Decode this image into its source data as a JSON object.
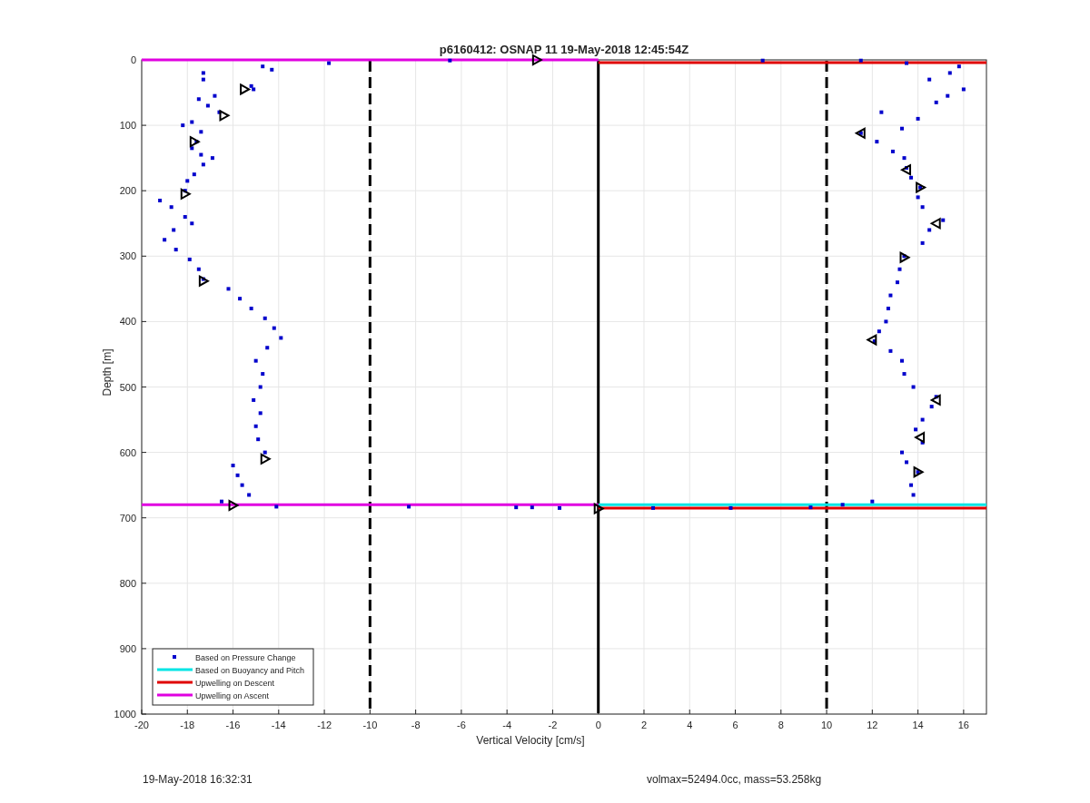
{
  "chart_data": {
    "type": "scatter",
    "title": "p6160412: OSNAP 11 19-May-2018 12:45:54Z",
    "xlabel": "Vertical Velocity [cm/s]",
    "ylabel": "Depth [m]",
    "xlim": [
      -20,
      17
    ],
    "ylim": [
      1000,
      0
    ],
    "xticks": [
      -20,
      -18,
      -16,
      -14,
      -12,
      -10,
      -8,
      -6,
      -4,
      -2,
      0,
      2,
      4,
      6,
      8,
      10,
      12,
      14,
      16
    ],
    "yticks": [
      0,
      100,
      200,
      300,
      400,
      500,
      600,
      700,
      800,
      900,
      1000
    ],
    "series": [
      {
        "name": "Based on Pressure Change",
        "type": "scatter",
        "color": "#0000cc",
        "x": [
          -14.7,
          -14.3,
          -17.3,
          -17.3,
          -15.2,
          -15.1,
          -16.8,
          -17.5,
          -17.1,
          -16.6,
          -17.8,
          -18.2,
          -17.4,
          -17.6,
          -17.8,
          -17.4,
          -16.9,
          -17.3,
          -17.7,
          -18,
          -18.1,
          -19.2,
          -18.7,
          -18.1,
          -17.8,
          -18.6,
          -19,
          -18.5,
          -17.9,
          -17.5,
          -17.3,
          -16.2,
          -15.7,
          -15.2,
          -14.6,
          -14.2,
          -13.9,
          -14.5,
          -15,
          -14.7,
          -14.8,
          -15.1,
          -14.8,
          -15,
          -14.9,
          -14.6,
          -16,
          -15.8,
          -15.6,
          -15.3,
          -16.5,
          -14.1,
          -8.3,
          -3.6,
          -2.9,
          -1.7,
          -11.8,
          -6.5,
          7.2,
          11.5,
          13.5,
          15.8,
          15.4,
          14.5,
          16,
          15.3,
          14.8,
          12.4,
          14,
          13.3,
          11.5,
          12.2,
          12.9,
          13.4,
          13.5,
          13.7,
          14.1,
          14,
          14.2,
          15.1,
          14.5,
          14.2,
          13.4,
          13.2,
          13.1,
          12.8,
          12.7,
          12.6,
          12.3,
          12.1,
          12.8,
          13.3,
          13.4,
          13.8,
          14.8,
          14.6,
          14.2,
          13.9,
          14.2,
          13.3,
          13.5,
          14,
          13.7,
          13.8,
          12,
          10.7,
          9.3,
          5.8,
          2.4
        ],
        "values": [
          10,
          15,
          20,
          30,
          40,
          45,
          55,
          60,
          70,
          80,
          95,
          100,
          110,
          125,
          135,
          145,
          150,
          160,
          175,
          185,
          200,
          215,
          225,
          240,
          250,
          260,
          275,
          290,
          305,
          320,
          335,
          350,
          365,
          380,
          395,
          410,
          425,
          440,
          460,
          480,
          500,
          520,
          540,
          560,
          580,
          600,
          620,
          635,
          650,
          665,
          675,
          683,
          683,
          684,
          684,
          685,
          5,
          1,
          1,
          1,
          5,
          10,
          20,
          30,
          45,
          55,
          65,
          80,
          90,
          105,
          112,
          125,
          140,
          150,
          165,
          180,
          195,
          210,
          225,
          245,
          260,
          280,
          300,
          320,
          340,
          360,
          380,
          400,
          415,
          430,
          445,
          460,
          480,
          500,
          515,
          530,
          550,
          565,
          585,
          600,
          615,
          630,
          650,
          665,
          675,
          680,
          684,
          685,
          685
        ]
      },
      {
        "name": "Based on Buoyancy and Pitch",
        "type": "line",
        "color": "#00e5e5",
        "x": [
          0,
          17
        ],
        "values": [
          680,
          680
        ]
      },
      {
        "name": "Upwelling on Descent",
        "type": "line",
        "color": "#e00000",
        "x": [
          0,
          17
        ],
        "values": [
          4,
          4
        ]
      },
      {
        "name": "Upwelling on Ascent",
        "type": "line",
        "color": "#e000e0",
        "x": [
          -20,
          0
        ],
        "values": [
          0,
          0
        ]
      },
      {
        "type": "line",
        "color": "#e00000",
        "x": [
          0,
          17
        ],
        "values": [
          685,
          685
        ]
      },
      {
        "type": "line",
        "color": "#e000e0",
        "x": [
          -20,
          0
        ],
        "values": [
          680,
          680
        ]
      },
      {
        "type": "scatter",
        "marker": "triangle-right",
        "color": "#000000",
        "x": [
          -2.7,
          -15.5,
          -16.4,
          -17.7,
          -18.1,
          -17.3,
          -14.6,
          -16,
          0,
          14.1,
          13.4,
          14
        ],
        "values": [
          0,
          45,
          85,
          125,
          205,
          338,
          610,
          681,
          686,
          195,
          302,
          630
        ]
      },
      {
        "type": "scatter",
        "marker": "triangle-left",
        "color": "#000000",
        "x": [
          11.5,
          13.5,
          14.8,
          12,
          14.8,
          14.1
        ],
        "values": [
          112,
          168,
          250,
          428,
          520,
          577
        ]
      }
    ],
    "ref_lines": [
      {
        "axis": "x",
        "value": -10,
        "color": "#000000"
      },
      {
        "axis": "x",
        "value": 0,
        "color": "#000000"
      },
      {
        "axis": "x",
        "value": 10,
        "color": "#000000"
      }
    ],
    "grid": true,
    "legend": true
  },
  "footer": {
    "timestamp": "19-May-2018 16:32:31",
    "summary": "volmax=52494.0cc, mass=53.258kg"
  }
}
